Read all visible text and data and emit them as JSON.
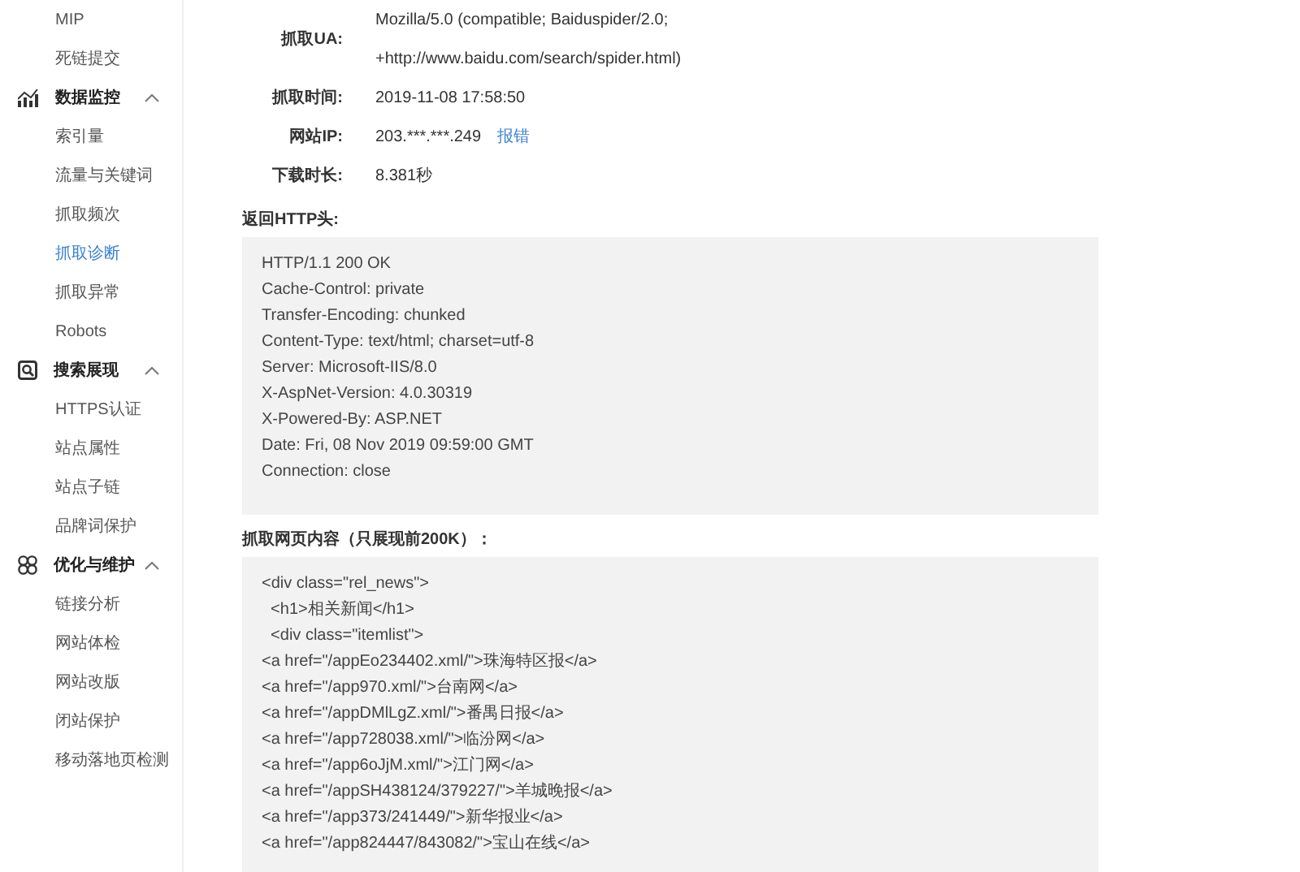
{
  "sidebar": {
    "items": [
      {
        "kind": "link",
        "label": "MIP",
        "selected": false
      },
      {
        "kind": "link",
        "label": "死链提交",
        "selected": false
      },
      {
        "kind": "group",
        "label": "数据监控",
        "expanded": true,
        "children": [
          {
            "label": "索引量",
            "selected": false
          },
          {
            "label": "流量与关键词",
            "selected": false
          },
          {
            "label": "抓取频次",
            "selected": false
          },
          {
            "label": "抓取诊断",
            "selected": true
          },
          {
            "label": "抓取异常",
            "selected": false
          },
          {
            "label": "Robots",
            "selected": false
          }
        ]
      },
      {
        "kind": "group",
        "label": "搜索展现",
        "expanded": true,
        "children": [
          {
            "label": "HTTPS认证",
            "selected": false
          },
          {
            "label": "站点属性",
            "selected": false
          },
          {
            "label": "站点子链",
            "selected": false
          },
          {
            "label": "品牌词保护",
            "selected": false
          }
        ]
      },
      {
        "kind": "group",
        "label": "优化与维护",
        "expanded": true,
        "children": [
          {
            "label": "链接分析",
            "selected": false
          },
          {
            "label": "网站体检",
            "selected": false
          },
          {
            "label": "网站改版",
            "selected": false
          },
          {
            "label": "闭站保护",
            "selected": false
          },
          {
            "label": "移动落地页检测",
            "selected": false
          }
        ]
      }
    ]
  },
  "details": [
    {
      "label": "抓取UA:",
      "lines": [
        "Mozilla/5.0 (compatible; Baiduspider/2.0;",
        "+http://www.baidu.com/search/spider.html)"
      ]
    },
    {
      "label": "抓取时间:",
      "lines": [
        "2019-11-08 17:58:50"
      ]
    },
    {
      "label": "网站IP:",
      "lines": [
        "203.***.***.249"
      ],
      "link": "报错"
    },
    {
      "label": "下载时长:",
      "lines": [
        "8.381秒"
      ]
    }
  ],
  "sections": [
    {
      "title": "返回HTTP头:",
      "lines": [
        "HTTP/1.1 200 OK",
        "Cache-Control: private",
        "Transfer-Encoding: chunked",
        "Content-Type: text/html; charset=utf-8",
        "Server: Microsoft-IIS/8.0",
        "X-AspNet-Version: 4.0.30319",
        "X-Powered-By: ASP.NET",
        "Date: Fri, 08 Nov 2019 09:59:00 GMT",
        "Connection: close"
      ]
    },
    {
      "title": "抓取网页内容（只展现前200K）：",
      "lines": [
        "<div class=\"rel_news\">",
        "  <h1>相关新闻</h1>",
        "  <div class=\"itemlist\">",
        "<a href=\"/appEo234402.xml/\">珠海特区报</a>",
        "<a href=\"/app970.xml/\">台南网</a>",
        "<a href=\"/appDMlLgZ.xml/\">番禺日报</a>",
        "<a href=\"/app728038.xml/\">临汾网</a>",
        "<a href=\"/app6oJjM.xml/\">江门网</a>",
        "<a href=\"/appSH438124/379227/\">羊城晚报</a>",
        "<a href=\"/app373/241449/\">新华报业</a>",
        "<a href=\"/app824447/843082/\">宝山在线</a>"
      ]
    }
  ]
}
